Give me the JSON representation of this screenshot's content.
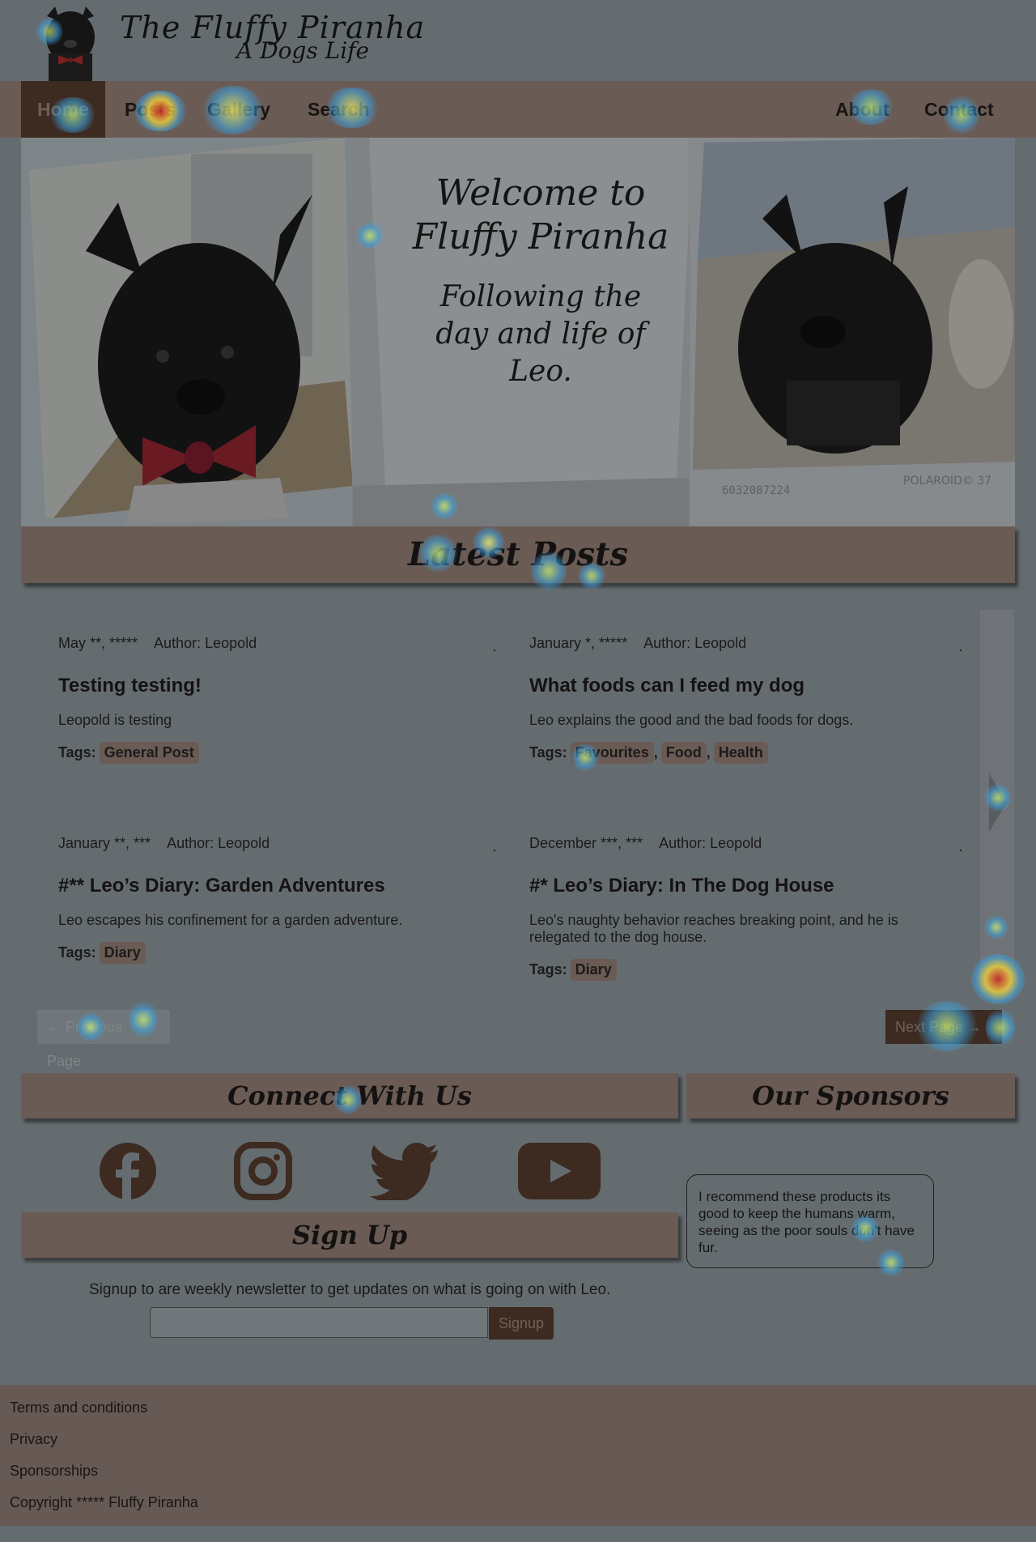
{
  "site": {
    "title": "The Fluffy Piranha",
    "subtitle": "A Dogs Life"
  },
  "nav": {
    "left": [
      "Home",
      "Posts",
      "Gallery",
      "Search"
    ],
    "right": [
      "About",
      "Contact"
    ],
    "active": "Home"
  },
  "hero": {
    "welcome_line1": "Welcome to",
    "welcome_line2": "Fluffy Piranha",
    "sub_line1": "Following the",
    "sub_line2": "day and life of",
    "sub_line3": "Leo.",
    "polaroid_caption": "6032087224",
    "polaroid_brand": "POLAROID© 37"
  },
  "latest_posts": {
    "heading": "Latest Posts",
    "posts": [
      {
        "date": "May **, *****",
        "author": "Author: Leopold",
        "title": "Testing testing!",
        "excerpt": "Leopold is testing",
        "tags_label": "Tags:",
        "tags": [
          "General Post"
        ]
      },
      {
        "date": "January *, *****",
        "author": "Author: Leopold",
        "title": "What foods can I feed my dog",
        "excerpt": "Leo explains the good and the bad foods for dogs.",
        "tags_label": "Tags:",
        "tags": [
          "Favourites",
          "Food",
          "Health"
        ]
      },
      {
        "date": "January **, ***",
        "author": "Author: Leopold",
        "title": "#** Leo’s Diary: Garden Adventures",
        "excerpt": "Leo escapes his confinement for a garden adventure.",
        "tags_label": "Tags:",
        "tags": [
          "Diary"
        ]
      },
      {
        "date": "December ***, ***",
        "author": "Author: Leopold",
        "title": "#* Leo’s Diary: In The Dog House",
        "excerpt": "Leo's naughty behavior reaches breaking point, and he is relegated to the dog house.",
        "tags_label": "Tags:",
        "tags": [
          "Diary"
        ]
      }
    ],
    "prev_label": "← Previous Page",
    "next_label": "Next Page →"
  },
  "connect": {
    "heading": "Connect With Us",
    "icons": [
      "facebook-icon",
      "instagram-icon",
      "twitter-icon",
      "youtube-icon"
    ]
  },
  "signup": {
    "heading": "Sign Up",
    "text": "Signup to are weekly newsletter to get updates on what is going on with Leo.",
    "input_value": "",
    "button_label": "Signup"
  },
  "sponsors": {
    "heading": "Our Sponsors",
    "text": "I recommend these products its good to keep the humans warm, seeing as the poor souls don't have fur."
  },
  "footer": {
    "links": [
      "Terms and conditions",
      "Privacy",
      "Sponsorships"
    ],
    "copyright": "Copyright ***** Fluffy Piranha"
  },
  "colors": {
    "background": "#656c70",
    "brown_panel": "#6a5b55",
    "dark_brown": "#3d2a20"
  }
}
